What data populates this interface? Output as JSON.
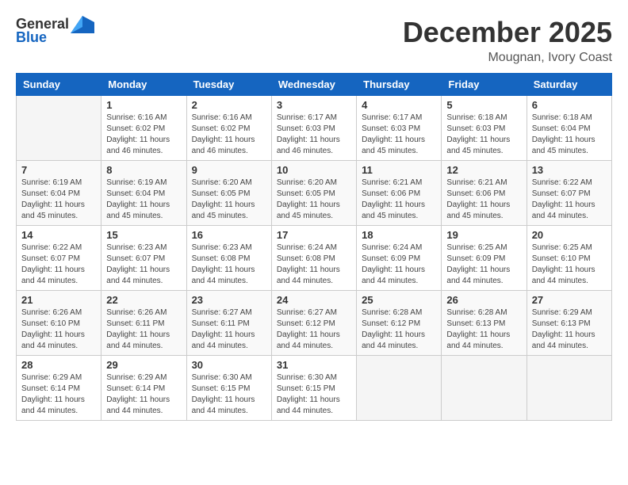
{
  "header": {
    "logo_general": "General",
    "logo_blue": "Blue",
    "month_year": "December 2025",
    "location": "Mougnan, Ivory Coast"
  },
  "days_of_week": [
    "Sunday",
    "Monday",
    "Tuesday",
    "Wednesday",
    "Thursday",
    "Friday",
    "Saturday"
  ],
  "weeks": [
    [
      {
        "day": "",
        "info": ""
      },
      {
        "day": "1",
        "info": "Sunrise: 6:16 AM\nSunset: 6:02 PM\nDaylight: 11 hours and 46 minutes."
      },
      {
        "day": "2",
        "info": "Sunrise: 6:16 AM\nSunset: 6:02 PM\nDaylight: 11 hours and 46 minutes."
      },
      {
        "day": "3",
        "info": "Sunrise: 6:17 AM\nSunset: 6:03 PM\nDaylight: 11 hours and 46 minutes."
      },
      {
        "day": "4",
        "info": "Sunrise: 6:17 AM\nSunset: 6:03 PM\nDaylight: 11 hours and 45 minutes."
      },
      {
        "day": "5",
        "info": "Sunrise: 6:18 AM\nSunset: 6:03 PM\nDaylight: 11 hours and 45 minutes."
      },
      {
        "day": "6",
        "info": "Sunrise: 6:18 AM\nSunset: 6:04 PM\nDaylight: 11 hours and 45 minutes."
      }
    ],
    [
      {
        "day": "7",
        "info": "Sunrise: 6:19 AM\nSunset: 6:04 PM\nDaylight: 11 hours and 45 minutes."
      },
      {
        "day": "8",
        "info": "Sunrise: 6:19 AM\nSunset: 6:04 PM\nDaylight: 11 hours and 45 minutes."
      },
      {
        "day": "9",
        "info": "Sunrise: 6:20 AM\nSunset: 6:05 PM\nDaylight: 11 hours and 45 minutes."
      },
      {
        "day": "10",
        "info": "Sunrise: 6:20 AM\nSunset: 6:05 PM\nDaylight: 11 hours and 45 minutes."
      },
      {
        "day": "11",
        "info": "Sunrise: 6:21 AM\nSunset: 6:06 PM\nDaylight: 11 hours and 45 minutes."
      },
      {
        "day": "12",
        "info": "Sunrise: 6:21 AM\nSunset: 6:06 PM\nDaylight: 11 hours and 45 minutes."
      },
      {
        "day": "13",
        "info": "Sunrise: 6:22 AM\nSunset: 6:07 PM\nDaylight: 11 hours and 44 minutes."
      }
    ],
    [
      {
        "day": "14",
        "info": "Sunrise: 6:22 AM\nSunset: 6:07 PM\nDaylight: 11 hours and 44 minutes."
      },
      {
        "day": "15",
        "info": "Sunrise: 6:23 AM\nSunset: 6:07 PM\nDaylight: 11 hours and 44 minutes."
      },
      {
        "day": "16",
        "info": "Sunrise: 6:23 AM\nSunset: 6:08 PM\nDaylight: 11 hours and 44 minutes."
      },
      {
        "day": "17",
        "info": "Sunrise: 6:24 AM\nSunset: 6:08 PM\nDaylight: 11 hours and 44 minutes."
      },
      {
        "day": "18",
        "info": "Sunrise: 6:24 AM\nSunset: 6:09 PM\nDaylight: 11 hours and 44 minutes."
      },
      {
        "day": "19",
        "info": "Sunrise: 6:25 AM\nSunset: 6:09 PM\nDaylight: 11 hours and 44 minutes."
      },
      {
        "day": "20",
        "info": "Sunrise: 6:25 AM\nSunset: 6:10 PM\nDaylight: 11 hours and 44 minutes."
      }
    ],
    [
      {
        "day": "21",
        "info": "Sunrise: 6:26 AM\nSunset: 6:10 PM\nDaylight: 11 hours and 44 minutes."
      },
      {
        "day": "22",
        "info": "Sunrise: 6:26 AM\nSunset: 6:11 PM\nDaylight: 11 hours and 44 minutes."
      },
      {
        "day": "23",
        "info": "Sunrise: 6:27 AM\nSunset: 6:11 PM\nDaylight: 11 hours and 44 minutes."
      },
      {
        "day": "24",
        "info": "Sunrise: 6:27 AM\nSunset: 6:12 PM\nDaylight: 11 hours and 44 minutes."
      },
      {
        "day": "25",
        "info": "Sunrise: 6:28 AM\nSunset: 6:12 PM\nDaylight: 11 hours and 44 minutes."
      },
      {
        "day": "26",
        "info": "Sunrise: 6:28 AM\nSunset: 6:13 PM\nDaylight: 11 hours and 44 minutes."
      },
      {
        "day": "27",
        "info": "Sunrise: 6:29 AM\nSunset: 6:13 PM\nDaylight: 11 hours and 44 minutes."
      }
    ],
    [
      {
        "day": "28",
        "info": "Sunrise: 6:29 AM\nSunset: 6:14 PM\nDaylight: 11 hours and 44 minutes."
      },
      {
        "day": "29",
        "info": "Sunrise: 6:29 AM\nSunset: 6:14 PM\nDaylight: 11 hours and 44 minutes."
      },
      {
        "day": "30",
        "info": "Sunrise: 6:30 AM\nSunset: 6:15 PM\nDaylight: 11 hours and 44 minutes."
      },
      {
        "day": "31",
        "info": "Sunrise: 6:30 AM\nSunset: 6:15 PM\nDaylight: 11 hours and 44 minutes."
      },
      {
        "day": "",
        "info": ""
      },
      {
        "day": "",
        "info": ""
      },
      {
        "day": "",
        "info": ""
      }
    ]
  ]
}
